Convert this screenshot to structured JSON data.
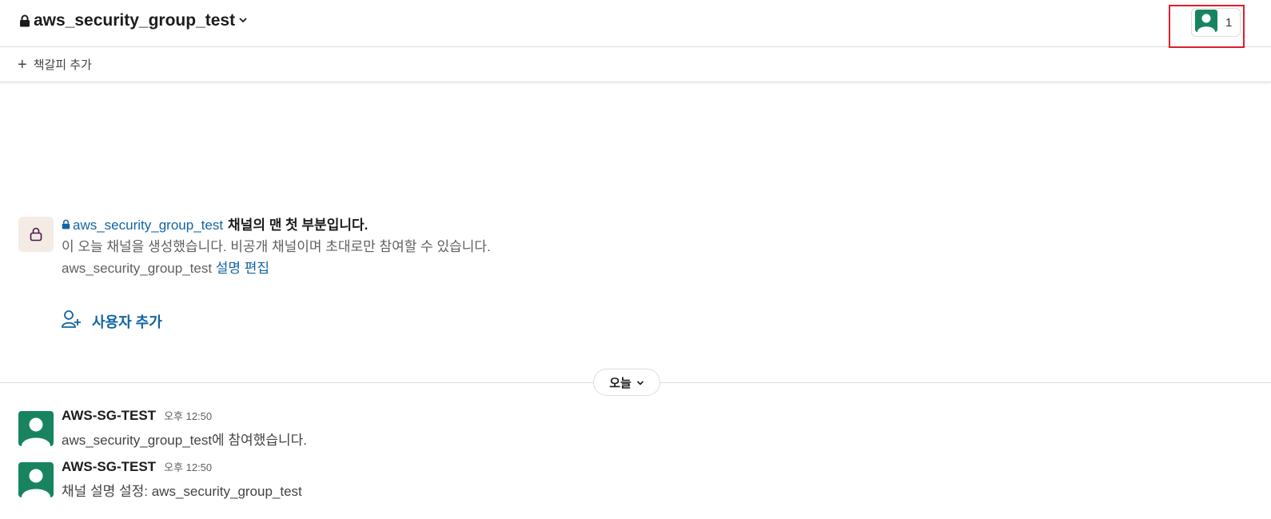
{
  "header": {
    "channel_name": "aws_security_group_test",
    "member_count": "1"
  },
  "bookmarks": {
    "add_label": "책갈피 추가"
  },
  "intro": {
    "channel_link": "aws_security_group_test",
    "title_suffix": "채널의 맨 첫 부분입니다.",
    "description": "이 오늘 채널을 생성했습니다. 비공개 채널이며 초대로만 참여할 수 있습니다.",
    "topic_text": "aws_security_group_test",
    "edit_link": "설명 편집",
    "add_user_label": "사용자 추가"
  },
  "date_divider": {
    "label": "오늘"
  },
  "messages": [
    {
      "author": "AWS-SG-TEST",
      "time": "오후 12:50",
      "text": "aws_security_group_test에 참여했습니다."
    },
    {
      "author": "AWS-SG-TEST",
      "time": "오후 12:50",
      "text": "채널 설명 설정: aws_security_group_test"
    }
  ],
  "colors": {
    "accent_link": "#1264a3",
    "avatar_bg": "#17845f",
    "highlight": "#e01e2c"
  }
}
